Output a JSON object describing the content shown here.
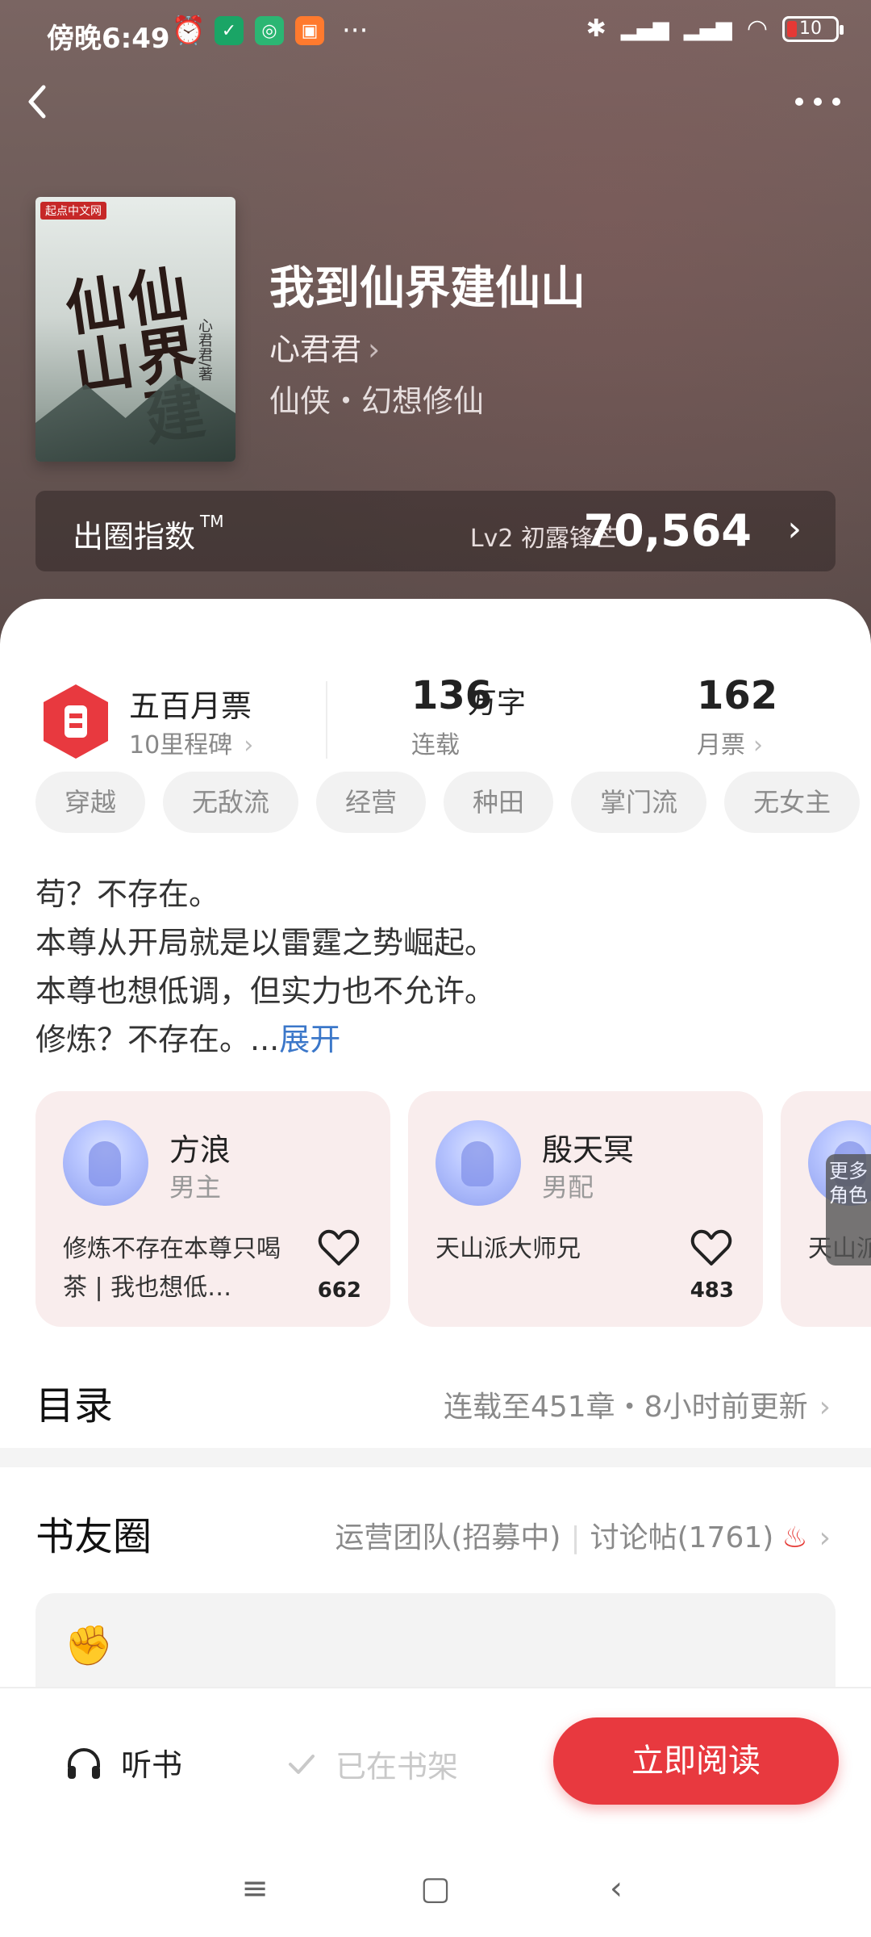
{
  "status_bar": {
    "time": "傍晚6:49",
    "dots": "···",
    "battery": "10"
  },
  "book": {
    "title": "我到仙界建仙山",
    "author": "心君君",
    "genre": "仙侠・幻想修仙",
    "cover": {
      "publisher": "起点中文网",
      "art_title": "仙界建仙山",
      "art_author": "心君君/著"
    }
  },
  "circle_index": {
    "label": "出圈指数",
    "tm": "TM",
    "level": "Lv2 初露锋芒",
    "score": "70,564"
  },
  "stats": {
    "milestone_title": "五百月票",
    "milestone_sub": "10里程碑",
    "words_num": "136",
    "words_unit": "万字",
    "words_sub": "连载",
    "votes_num": "162",
    "votes_sub": "月票"
  },
  "tags": [
    "穿越",
    "无敌流",
    "经营",
    "种田",
    "掌门流",
    "无女主"
  ],
  "intro": {
    "lines": [
      "苟？不存在。",
      "本尊从开局就是以雷霆之势崛起。",
      "本尊也想低调，但实力也不允许。",
      "修炼？不存在。..."
    ],
    "expand": "展开"
  },
  "characters": [
    {
      "name": "方浪",
      "role": "男主",
      "desc": "修炼不存在本尊只喝茶 | 我也想低…",
      "likes": "662"
    },
    {
      "name": "殷天冥",
      "role": "男配",
      "desc": "天山派大师兄",
      "likes": "483"
    },
    {
      "name": "",
      "role": "",
      "desc": "天山派",
      "likes": ""
    }
  ],
  "more_roles": "更多角色",
  "toc": {
    "label": "目录",
    "meta": "连载至451章・8小时前更新"
  },
  "book_circle": {
    "label": "书友圈",
    "team": "运营团队(招募中)",
    "discuss": "讨论帖(1761)"
  },
  "actions": {
    "listen": "听书",
    "shelf": "已在书架",
    "read": "立即阅读"
  },
  "colors": {
    "accent": "#e8393f",
    "link": "#3b77c9",
    "hero_bg": "#6d5b58"
  }
}
